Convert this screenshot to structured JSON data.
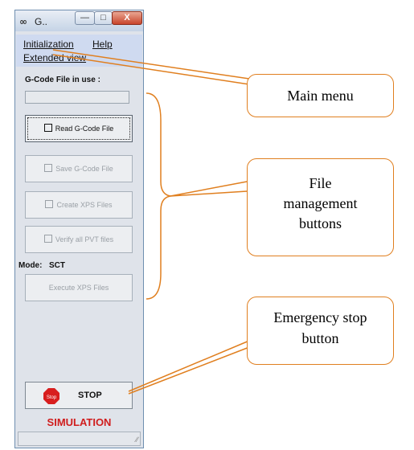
{
  "window": {
    "title": "G..",
    "icon": "link-chain-icon",
    "controls": {
      "minimize": "—",
      "maximize": "□",
      "close": "X"
    }
  },
  "menu": {
    "items": [
      {
        "label": "Initialization"
      },
      {
        "label": "Help"
      },
      {
        "label": "Extended view"
      }
    ]
  },
  "gcode": {
    "label": "G-Code File in use :",
    "value": ""
  },
  "buttons": {
    "read": "Read G-Code File",
    "save": "Save G-Code File",
    "create": "Create XPS Files",
    "verify": "Verify all PVT files",
    "execute": "Execute XPS Files"
  },
  "mode": {
    "label": "Mode:",
    "value": "SCT"
  },
  "stop": {
    "icon_text": "Stop",
    "label": "STOP"
  },
  "simulation_label": "SIMULATION",
  "callouts": {
    "main_menu": "Main menu",
    "file_management": "File management buttons",
    "emergency_stop": "Emergency stop button"
  },
  "colors": {
    "callout_border": "#e07f1f",
    "simulation": "#d01d1d",
    "stop_icon": "#d81e1e"
  }
}
